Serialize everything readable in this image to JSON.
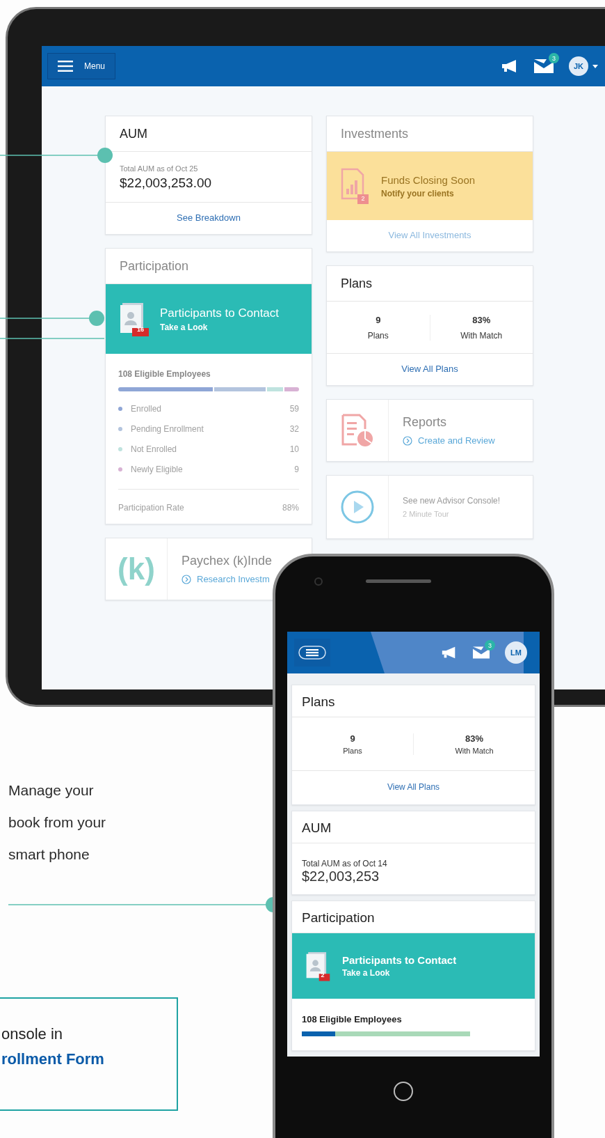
{
  "annotations": {
    "callout": "Manage your book from your smart phone",
    "promo_lines": [
      {
        "kind": "plain",
        "text": "onsole in"
      },
      {
        "kind": "link",
        "text": "rollment Form"
      }
    ]
  },
  "tablet": {
    "header": {
      "menu_label": "Menu",
      "mail_badge": "3",
      "avatar": "JK"
    },
    "aum": {
      "title": "AUM",
      "caption": "Total AUM as of Oct 25",
      "amount": "$22,003,253.00",
      "link": "See Breakdown"
    },
    "participation": {
      "title": "Participation",
      "alert": {
        "title": "Participants to Contact",
        "subtitle": "Take a Look",
        "badge": "16"
      },
      "eligible": "108 Eligible Employees",
      "groups": [
        {
          "label": "Enrolled",
          "count": "59",
          "color": "#8fa6d6"
        },
        {
          "label": "Pending Enrollment",
          "count": "32",
          "color": "#b3c4de"
        },
        {
          "label": "Not Enrolled",
          "count": "10",
          "color": "#bfe3df"
        },
        {
          "label": "Newly Eligible",
          "count": "9",
          "color": "#d8b2d4"
        }
      ],
      "rate_label": "Participation Rate",
      "rate": "88%"
    },
    "paychex": {
      "logo": "(k)",
      "title": "Paychex (k)Inde",
      "link": "Research Investm"
    },
    "investments": {
      "title": "Investments",
      "alert": {
        "title": "Funds Closing Soon",
        "subtitle": "Notify your clients",
        "badge": "2"
      },
      "link": "View All Investments"
    },
    "plans": {
      "title": "Plans",
      "stats": [
        {
          "value": "9",
          "label": "Plans"
        },
        {
          "value": "83%",
          "label": "With Match"
        }
      ],
      "link": "View All Plans"
    },
    "reports": {
      "title": "Reports",
      "link": "Create and Review"
    },
    "tour": {
      "title": "See new Advisor Console!",
      "subtitle": "2 Minute Tour"
    }
  },
  "phone": {
    "header": {
      "mail_badge": "3",
      "avatar": "LM"
    },
    "plans": {
      "title": "Plans",
      "stats": [
        {
          "value": "9",
          "label": "Plans"
        },
        {
          "value": "83%",
          "label": "With Match"
        }
      ],
      "link": "View All Plans"
    },
    "aum": {
      "title": "AUM",
      "caption": "Total AUM as of Oct 14",
      "amount": "$22,003,253"
    },
    "participation": {
      "title": "Participation",
      "alert": {
        "title": "Participants to Contact",
        "subtitle": "Take a Look",
        "badge": "2"
      },
      "eligible": "108 Eligible Employees",
      "level": 0.2
    }
  }
}
